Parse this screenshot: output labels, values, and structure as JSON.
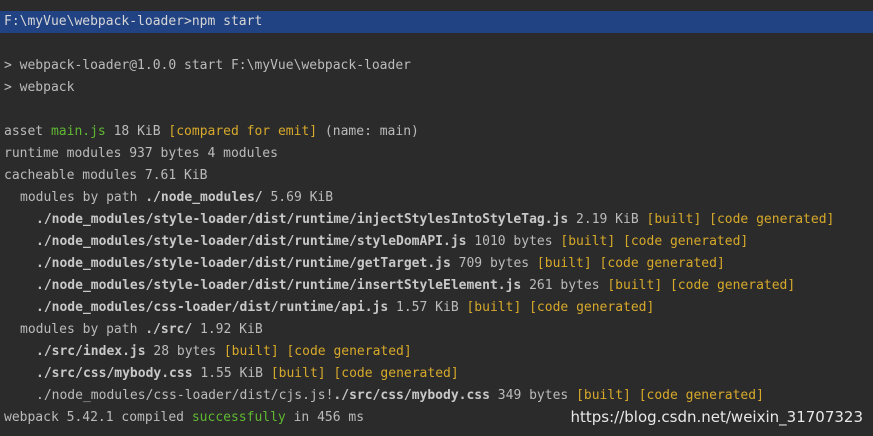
{
  "terminal": {
    "command_line": "F:\\myVue\\webpack-loader>npm start",
    "script_line1": "> webpack-loader@1.0.0 start F:\\myVue\\webpack-loader",
    "script_line2": "> webpack",
    "asset": {
      "prefix": "asset ",
      "file": "main.js",
      "size": " 18 KiB ",
      "status": "[compared for emit]",
      "suffix": " (name: main)"
    },
    "runtime_modules": "runtime modules 937 bytes 4 modules",
    "cacheable_modules": "cacheable modules 7.61 KiB",
    "node_modules_group": {
      "prefix": "modules by path ",
      "path": "./node_modules/",
      "size": " 5.69 KiB"
    },
    "node_modules": [
      {
        "path": "./node_modules/style-loader/dist/runtime/injectStylesIntoStyleTag.js",
        "size": " 2.19 KiB ",
        "built": "[built]",
        "generated": "[code generated]"
      },
      {
        "path": "./node_modules/style-loader/dist/runtime/styleDomAPI.js",
        "size": " 1010 bytes ",
        "built": "[built]",
        "generated": "[code generated]"
      },
      {
        "path": "./node_modules/style-loader/dist/runtime/getTarget.js",
        "size": " 709 bytes ",
        "built": "[built]",
        "generated": "[code generated]"
      },
      {
        "path": "./node_modules/style-loader/dist/runtime/insertStyleElement.js",
        "size": " 261 bytes ",
        "built": "[built]",
        "generated": "[code generated]"
      },
      {
        "path": "./node_modules/css-loader/dist/runtime/api.js",
        "size": " 1.57 KiB ",
        "built": "[built]",
        "generated": "[code generated]"
      }
    ],
    "src_group": {
      "prefix": "modules by path ",
      "path": "./src/",
      "size": " 1.92 KiB"
    },
    "src_modules": [
      {
        "path": "./src/index.js",
        "size": " 28 bytes ",
        "built": "[built]",
        "generated": "[code generated]"
      },
      {
        "path": "./src/css/mybody.css",
        "size": " 1.55 KiB ",
        "built": "[built]",
        "generated": "[code generated]"
      }
    ],
    "loader_module": {
      "prefix": "./node_modules/css-loader/dist/cjs.js!",
      "path": "./src/css/mybody.css",
      "size": " 349 bytes ",
      "built": "[built]",
      "generated": "[code generated]"
    },
    "compiled": {
      "prefix": "webpack 5.42.1 compiled ",
      "status": "successfully",
      "suffix": " in 456 ms"
    },
    "watermark": "https://blog.csdn.net/weixin_31707323"
  },
  "colors": {
    "background": "#2b2b2b",
    "selection": "#214283",
    "success": "#5fb832",
    "status": "#d7a92a"
  }
}
